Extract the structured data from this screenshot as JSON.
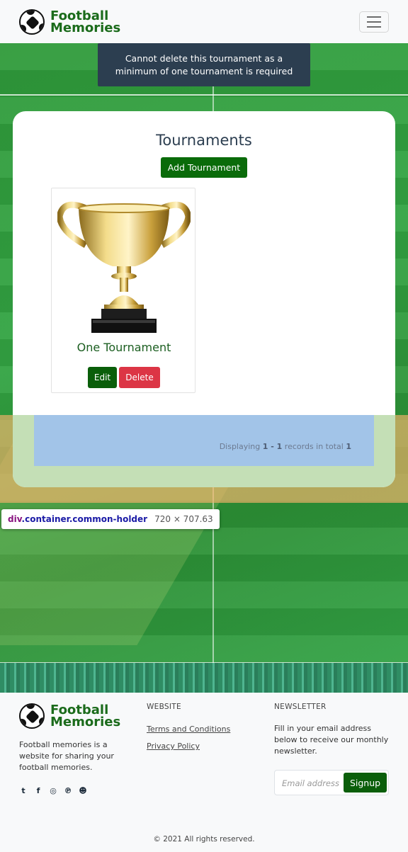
{
  "navbar": {
    "brand_line1": "Football",
    "brand_line2": "Memories"
  },
  "toast": {
    "message": "Cannot delete this tournament as a minimum of one tournament is required"
  },
  "main": {
    "title": "Tournaments",
    "add_button": "Add Tournament",
    "tournaments": [
      {
        "name": "One Tournament",
        "edit_label": "Edit",
        "delete_label": "Delete",
        "image": "trophy"
      }
    ],
    "records": {
      "prefix": "Displaying",
      "range": "1 - 1",
      "middle": "records in total",
      "total": "1"
    }
  },
  "devtools_tooltip": {
    "tag": "div",
    "classes": ".container.common-holder",
    "dimensions": "720 × 707.63"
  },
  "footer": {
    "brand_line1": "Football",
    "brand_line2": "Memories",
    "description": "Football memories is a website for sharing your football memories.",
    "social_icons": [
      "twitter-icon",
      "facebook-icon",
      "instagram-icon",
      "pinterest-icon",
      "snapchat-icon"
    ],
    "website_heading": "WEBSITE",
    "links": [
      "Terms and Conditions",
      "Privacy Policy"
    ],
    "newsletter_heading": "NEWSLETTER",
    "newsletter_text": "Fill in your email address below to receive our monthly newsletter.",
    "email_placeholder": "Email address",
    "signup_label": "Signup",
    "copyright": "© 2021 All rights reserved."
  },
  "colors": {
    "brand_green": "#0a6b0a",
    "danger": "#dc3545",
    "toast_bg": "#2c3e50"
  }
}
